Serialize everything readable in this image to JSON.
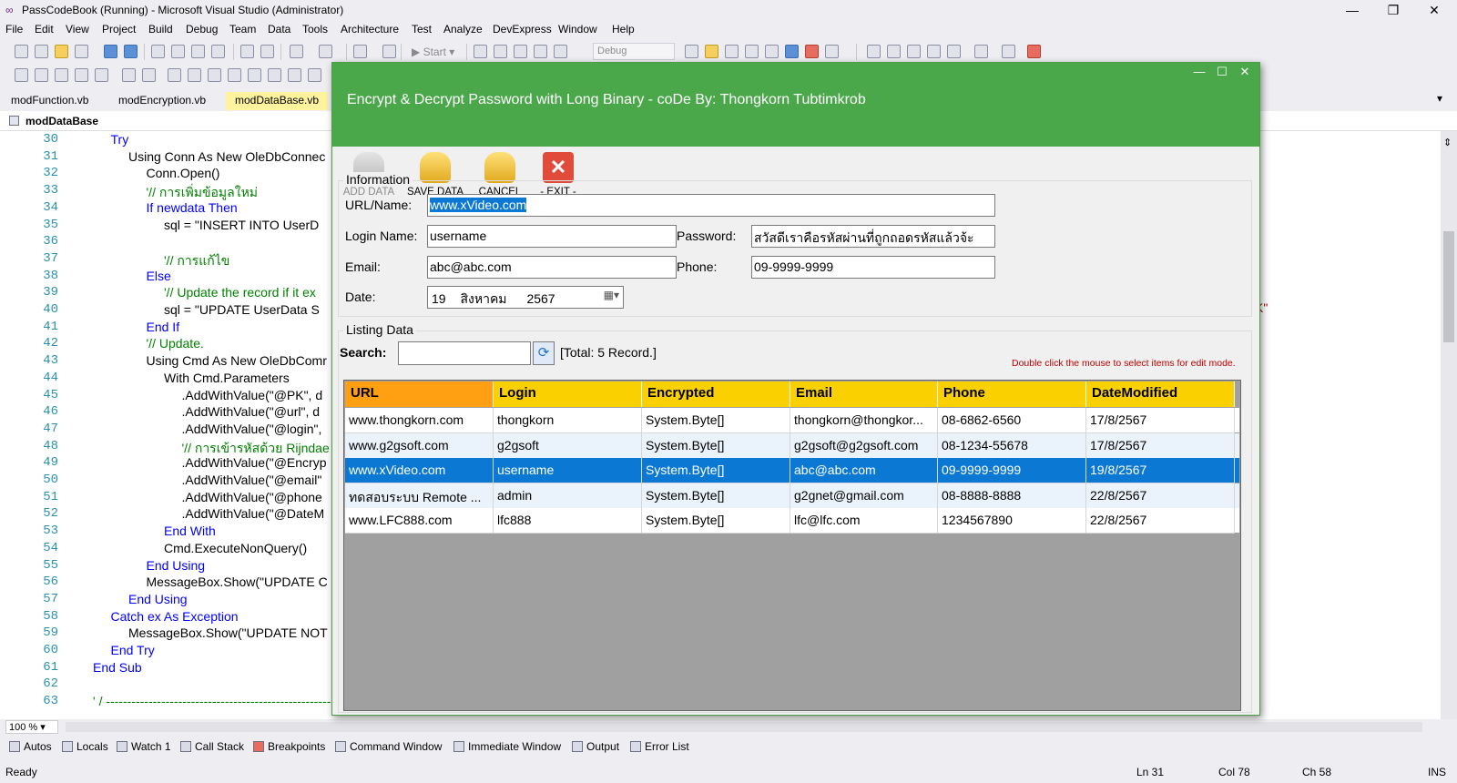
{
  "window": {
    "title": "PassCodeBook (Running) - Microsoft Visual Studio (Administrator)",
    "min": "—",
    "max": "❐",
    "close": "✕"
  },
  "menu": [
    "File",
    "Edit",
    "View",
    "Project",
    "Build",
    "Debug",
    "Team",
    "Data",
    "Tools",
    "Architecture",
    "Test",
    "Analyze",
    "DevExpress",
    "Window",
    "Help"
  ],
  "toolbar": {
    "start": "Start",
    "config": "Debug"
  },
  "tabs": [
    "modFunction.vb",
    "modEncryption.vb",
    "modDataBase.vb"
  ],
  "navbar": {
    "module": "modDataBase"
  },
  "code": [
    {
      "n": "30",
      "t": "Try"
    },
    {
      "n": "31",
      "t": "Using Conn As New OleDbConnec"
    },
    {
      "n": "32",
      "t": "Conn.Open()"
    },
    {
      "n": "33",
      "t": "'// การเพิ่มข้อมูลใหม่"
    },
    {
      "n": "34",
      "t": "If newdata Then"
    },
    {
      "n": "35",
      "t": "sql = \"INSERT INTO UserD"
    },
    {
      "n": "36",
      "t": ""
    },
    {
      "n": "37",
      "t": "'// การแก้ไข"
    },
    {
      "n": "38",
      "t": "Else"
    },
    {
      "n": "39",
      "t": "'// Update the record if it ex"
    },
    {
      "n": "40",
      "t": "sql = \"UPDATE UserData S"
    },
    {
      "n": "41",
      "t": "End If"
    },
    {
      "n": "42",
      "t": "'// Update."
    },
    {
      "n": "43",
      "t": "Using Cmd As New OleDbComr"
    },
    {
      "n": "44",
      "t": "With Cmd.Parameters"
    },
    {
      "n": "45",
      "t": ".AddWithValue(\"@PK\", d"
    },
    {
      "n": "46",
      "t": ".AddWithValue(\"@url\", d"
    },
    {
      "n": "47",
      "t": ".AddWithValue(\"@login\","
    },
    {
      "n": "48",
      "t": "'// การเข้ารหัสด้วย Rijndae"
    },
    {
      "n": "49",
      "t": ".AddWithValue(\"@Encryp"
    },
    {
      "n": "50",
      "t": ".AddWithValue(\"@email\""
    },
    {
      "n": "51",
      "t": ".AddWithValue(\"@phone"
    },
    {
      "n": "52",
      "t": ".AddWithValue(\"@DateM"
    },
    {
      "n": "53",
      "t": "End With"
    },
    {
      "n": "54",
      "t": "Cmd.ExecuteNonQuery()"
    },
    {
      "n": "55",
      "t": "End Using"
    },
    {
      "n": "56",
      "t": "MessageBox.Show(\"UPDATE C"
    },
    {
      "n": "57",
      "t": "End Using"
    },
    {
      "n": "58",
      "t": "Catch ex As Exception"
    },
    {
      "n": "59",
      "t": "MessageBox.Show(\"UPDATE NOT"
    },
    {
      "n": "60",
      "t": "End Try"
    },
    {
      "n": "61",
      "t": "End Sub"
    },
    {
      "n": "62",
      "t": ""
    },
    {
      "n": "63",
      "t": "' / ------------------------------------------------------------------------------------------------------------------------------------------------------------------------------------------------"
    }
  ],
  "code_right_tail": "K\"",
  "zoom": "100 %",
  "toolwindows": [
    "Autos",
    "Locals",
    "Watch 1",
    "Call Stack",
    "Breakpoints",
    "Command Window",
    "Immediate Window",
    "Output",
    "Error List"
  ],
  "status": {
    "ready": "Ready",
    "ln": "Ln 31",
    "col": "Col 78",
    "ch": "Ch 58",
    "ins": "INS"
  },
  "dialog": {
    "title": "Encrypt & Decrypt Password with Long Binary - coDe By: Thongkorn Tubtimkrob",
    "toolbar": {
      "add": "ADD DATA",
      "save": "SAVE DATA",
      "cancel": "CANCEL",
      "exit": "-  EXIT  -"
    },
    "info": {
      "legend": "Information",
      "url_label": "URL/Name:",
      "url": "www.xVideo.com",
      "login_label": "Login Name:",
      "login": "username",
      "password_label": "Password:",
      "password": "สวัสดีเราคือรหัสผ่านที่ถูกถอดรหัสแล้วจ้ะ",
      "email_label": "Email:",
      "email": "abc@abc.com",
      "phone_label": "Phone:",
      "phone": "09-9999-9999",
      "date_label": "Date:",
      "date_day": "19",
      "date_month": "สิงหาคม",
      "date_year": "2567"
    },
    "listing": {
      "legend": "Listing Data",
      "search_label": "Search:",
      "search_value": "",
      "total": "[Total: 5 Record.]",
      "hint": "Double click the mouse to select items for edit mode."
    },
    "columns": [
      "URL",
      "Login",
      "Encrypted",
      "Email",
      "Phone",
      "DateModified"
    ],
    "rows": [
      [
        "www.thongkorn.com",
        "thongkorn",
        "System.Byte[]",
        "thongkorn@thongkor...",
        "08-6862-6560",
        "17/8/2567"
      ],
      [
        "www.g2gsoft.com",
        "g2gsoft",
        "System.Byte[]",
        "g2gsoft@g2gsoft.com",
        "08-1234-55678",
        "17/8/2567"
      ],
      [
        "www.xVideo.com",
        "username",
        "System.Byte[]",
        "abc@abc.com",
        "09-9999-9999",
        "19/8/2567"
      ],
      [
        "ทดสอบระบบ Remote ...",
        "admin",
        "System.Byte[]",
        "g2gnet@gmail.com",
        "08-8888-8888",
        "22/8/2567"
      ],
      [
        "www.LFC888.com",
        "lfc888",
        "System.Byte[]",
        "lfc@lfc.com",
        "1234567890",
        "22/8/2567"
      ]
    ],
    "selected_row": 2
  },
  "colors": {
    "dialog_header": "#4aa84a",
    "grid_header": "#fad000",
    "grid_header_first": "#ff9f11",
    "selected": "#0b78d4",
    "alt_row": "#eaf3fb",
    "code_keyword": "#0000ff",
    "code_type": "#2b91af",
    "code_string": "#a31515",
    "code_comment": "#008000"
  }
}
